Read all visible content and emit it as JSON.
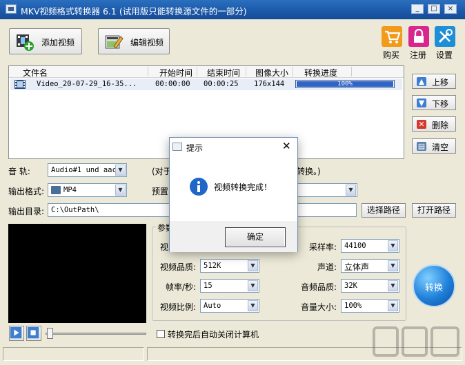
{
  "window": {
    "title": "MKV视频格式转换器 6.1 (试用版只能转换源文件的一部分)",
    "controls": [
      "_",
      "□",
      "×"
    ]
  },
  "toolbar": {
    "add_video": "添加视频",
    "edit_video": "编辑视频",
    "buy": "购买",
    "register": "注册",
    "settings": "设置"
  },
  "file_list": {
    "headers": [
      "文件名",
      "开始时间",
      "结束时间",
      "图像大小",
      "转换进度"
    ],
    "rows": [
      {
        "name": "Video_20-07-29_16-35...",
        "start": "00:00:00",
        "end": "00:00:25",
        "size": "176x144",
        "progress_label": "100%",
        "progress": 1.0
      }
    ]
  },
  "side_buttons": {
    "up": "上移",
    "down": "下移",
    "delete": "删除",
    "clear": "清空"
  },
  "options": {
    "audio_track_label": "音    轨:",
    "audio_track_value": "Audio#1 und aac",
    "audio_note_left": "(对于",
    "audio_note_right": "转换。)",
    "format_label": "输出格式:",
    "format_value": "MP4",
    "preset_label": "预置",
    "output_dir_label": "输出目录:",
    "output_dir_value": "C:\\OutPath\\",
    "choose_path": "选择路径",
    "open_path": "打开路径"
  },
  "params": {
    "group_label": "参数",
    "video_label": "视",
    "sample_rate_label": "采样率:",
    "sample_rate_value": "44100",
    "video_quality_label": "视频品质:",
    "video_quality_value": "512K",
    "channel_label": "声道:",
    "channel_value": "立体声",
    "fps_label": "帧率/秒:",
    "fps_value": "15",
    "audio_quality_label": "音频品质:",
    "audio_quality_value": "32K",
    "aspect_label": "视频比例:",
    "aspect_value": "Auto",
    "volume_label": "音量大小:",
    "volume_value": "100%"
  },
  "convert_label": "转换",
  "shutdown_label": "转换完后自动关闭计算机",
  "dialog": {
    "title": "提示",
    "message": "视频转换完成！",
    "ok": "确定"
  },
  "colors": {
    "titlebar": "#1b58a8",
    "progress": "#2f64c8",
    "convert": "#1f7fd9"
  }
}
